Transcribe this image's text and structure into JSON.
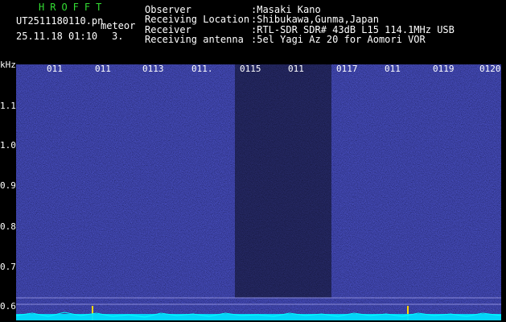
{
  "header": {
    "brand": "HROFFT",
    "file_name": "UT2511180110.pn",
    "meteor_label": "meteor",
    "timestamp": "25.11.18 01:10",
    "channel": "3.",
    "labels": [
      "Observer",
      "Receiving Location",
      "Receiver",
      "Receiving antenna"
    ],
    "values": [
      ":Masaki Kano",
      ":Shibukawa,Gunma,Japan",
      ":RTL-SDR SDR# 43dB L15 114.1MHz USB",
      ":5el Yagi Az 20 for Aomori VOR"
    ]
  },
  "colors": {
    "brand": "#33dd33",
    "background": "#000000",
    "spectrogram": "#1a1a8a",
    "baseline": "#00ddff"
  },
  "spectrogram": {
    "unit": "kHz",
    "y_ticks": [
      "1.1",
      "1.0",
      "0.9",
      "0.8",
      "0.7",
      "0.6"
    ],
    "x_ticks": [
      "011",
      "011",
      "0113",
      "011.",
      "0115",
      "011",
      "0117",
      "011",
      "0119",
      "0120"
    ]
  }
}
